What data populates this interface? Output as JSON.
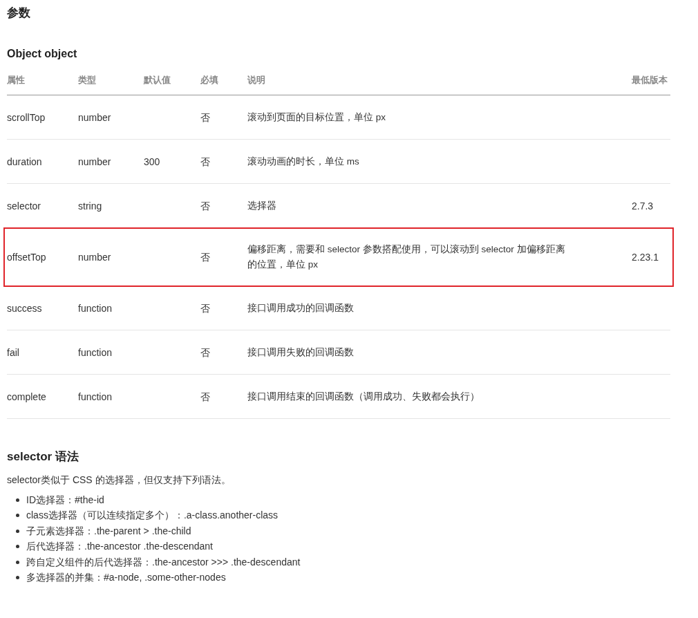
{
  "title": "参数",
  "object_heading": "Object object",
  "table": {
    "columns": [
      "属性",
      "类型",
      "默认值",
      "必填",
      "说明",
      "最低版本"
    ],
    "rows": [
      {
        "cells": [
          "scrollTop",
          "number",
          "",
          "否",
          "滚动到页面的目标位置，单位 px",
          ""
        ],
        "highlighted": false
      },
      {
        "cells": [
          "duration",
          "number",
          "300",
          "否",
          "滚动动画的时长，单位 ms",
          ""
        ],
        "highlighted": false
      },
      {
        "cells": [
          "selector",
          "string",
          "",
          "否",
          "选择器",
          "2.7.3"
        ],
        "highlighted": false
      },
      {
        "cells": [
          "offsetTop",
          "number",
          "",
          "否",
          "偏移距离，需要和 selector 参数搭配使用，可以滚动到 selector 加偏移距离的位置，单位 px",
          "2.23.1"
        ],
        "highlighted": true
      },
      {
        "cells": [
          "success",
          "function",
          "",
          "否",
          "接口调用成功的回调函数",
          ""
        ],
        "highlighted": false
      },
      {
        "cells": [
          "fail",
          "function",
          "",
          "否",
          "接口调用失败的回调函数",
          ""
        ],
        "highlighted": false
      },
      {
        "cells": [
          "complete",
          "function",
          "",
          "否",
          "接口调用结束的回调函数（调用成功、失败都会执行）",
          ""
        ],
        "highlighted": false
      }
    ]
  },
  "selector_heading": "selector 语法",
  "intro": "selector类似于 CSS 的选择器，但仅支持下列语法。",
  "items": [
    "ID选择器：#the-id",
    "class选择器（可以连续指定多个）：.a-class.another-class",
    "子元素选择器：.the-parent > .the-child",
    "后代选择器：.the-ancestor .the-descendant",
    "跨自定义组件的后代选择器：.the-ancestor >>> .the-descendant",
    "多选择器的并集：#a-node, .some-other-nodes"
  ]
}
